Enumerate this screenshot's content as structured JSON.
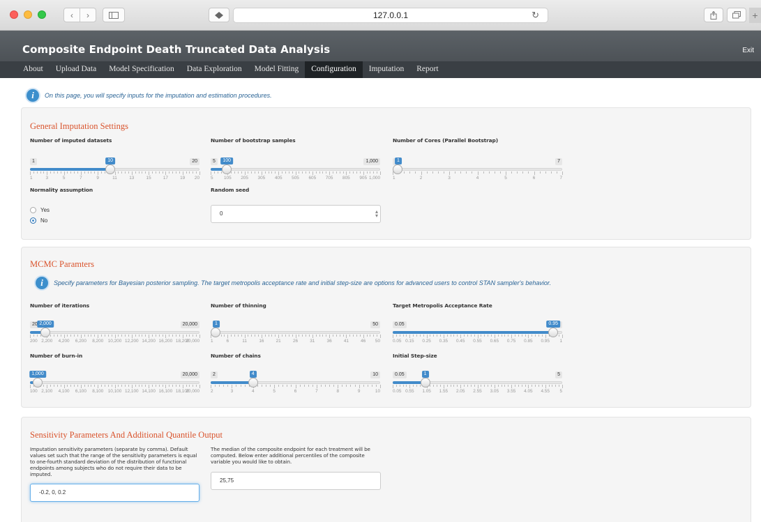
{
  "browser": {
    "url": "127.0.0.1"
  },
  "header": {
    "title": "Composite Endpoint Death Truncated Data Analysis",
    "exit_label": "Exit"
  },
  "nav": {
    "tabs": [
      {
        "label": "About"
      },
      {
        "label": "Upload Data"
      },
      {
        "label": "Model Specification"
      },
      {
        "label": "Data Exploration"
      },
      {
        "label": "Model Fitting"
      },
      {
        "label": "Configuration",
        "active": true
      },
      {
        "label": "Imputation"
      },
      {
        "label": "Report"
      }
    ]
  },
  "intro": {
    "text": "On this page, you will specify inputs for the imputation and estimation procedures."
  },
  "general": {
    "title": "General Imputation Settings",
    "imputed": {
      "label": "Number of imputed datasets",
      "min": "1",
      "max": "20",
      "value": "10",
      "fraction": 0.4737,
      "grid": [
        "1",
        "3",
        "5",
        "7",
        "9",
        "11",
        "13",
        "15",
        "17",
        "19",
        "20"
      ]
    },
    "bootstrap": {
      "label": "Number of bootstrap samples",
      "min": "5",
      "max": "1,000",
      "value": "100",
      "fraction": 0.0955,
      "grid": [
        "5",
        "105",
        "205",
        "305",
        "405",
        "505",
        "605",
        "705",
        "805",
        "905",
        "1,000"
      ]
    },
    "cores": {
      "label": "Number of Cores (Parallel Bootstrap)",
      "min": "1",
      "max": "7",
      "value": "1",
      "fraction": 0.0,
      "grid": [
        "1",
        "2",
        "3",
        "4",
        "5",
        "6",
        "7"
      ]
    },
    "normality": {
      "label": "Normality assumption",
      "options": [
        "Yes",
        "No"
      ],
      "selected": "No"
    },
    "seed": {
      "label": "Random seed",
      "value": "0"
    }
  },
  "mcmc": {
    "title": "MCMC Paramters",
    "info": "Specify parameters for Bayesian posterior sampling. The target metropolis acceptance rate and initial step-size are options for advanced users to control STAN sampler's behavior.",
    "iterations": {
      "label": "Number of iterations",
      "min": "200",
      "max": "20,000",
      "value": "2,000",
      "fraction": 0.0909,
      "grid": [
        "200",
        "2,200",
        "4,200",
        "6,200",
        "8,200",
        "10,200",
        "12,200",
        "14,200",
        "16,200",
        "18,200",
        "20,000"
      ]
    },
    "thinning": {
      "label": "Number of thinning",
      "min": "",
      "max": "50",
      "value": "1",
      "fraction": 0.0,
      "grid": [
        "1",
        "6",
        "11",
        "16",
        "21",
        "26",
        "31",
        "36",
        "41",
        "46",
        "50"
      ]
    },
    "acceptance": {
      "label": "Target Metropolis Acceptance Rate",
      "min": "0.05",
      "max": "1",
      "value": "0.95",
      "fraction": 0.9474,
      "grid": [
        "0.05",
        "0.15",
        "0.25",
        "0.35",
        "0.45",
        "0.55",
        "0.65",
        "0.75",
        "0.85",
        "0.95",
        "1"
      ]
    },
    "burnin": {
      "label": "Number of burn-in",
      "min": "",
      "max": "20,000",
      "value": "1,000",
      "fraction": 0.0452,
      "grid": [
        "100",
        "2,100",
        "4,100",
        "6,100",
        "8,100",
        "10,100",
        "12,100",
        "14,100",
        "16,100",
        "18,100",
        "20,000"
      ]
    },
    "chains": {
      "label": "Number of chains",
      "min": "2",
      "max": "10",
      "value": "4",
      "fraction": 0.25,
      "grid": [
        "2",
        "3",
        "4",
        "5",
        "6",
        "7",
        "8",
        "9",
        "10"
      ]
    },
    "stepsize": {
      "label": "Initial Step-size",
      "min": "0.05",
      "max": "5",
      "value": "1",
      "fraction": 0.1919,
      "grid": [
        "0.05",
        "0.55",
        "1.05",
        "1.55",
        "2.05",
        "2.55",
        "3.05",
        "3.55",
        "4.05",
        "4.55",
        "5"
      ]
    }
  },
  "sensitivity": {
    "title": "Sensitivity Parameters And Additional Quantile Output",
    "params_label": "Imputation sensitivity parameters (separate by comma). Default values set such that the range of the sensitivity parameters is equal to one-fourth standard deviation of the distribution of functional endpoints among subjects who do not require their data to be imputed.",
    "params_value": "-0.2, 0, 0.2",
    "quantile_label": "The median of the composite endpoint for each treatment will be computed. Below enter additional percentiles of the composite variable you would like to obtain.",
    "quantile_value": "25,75"
  }
}
